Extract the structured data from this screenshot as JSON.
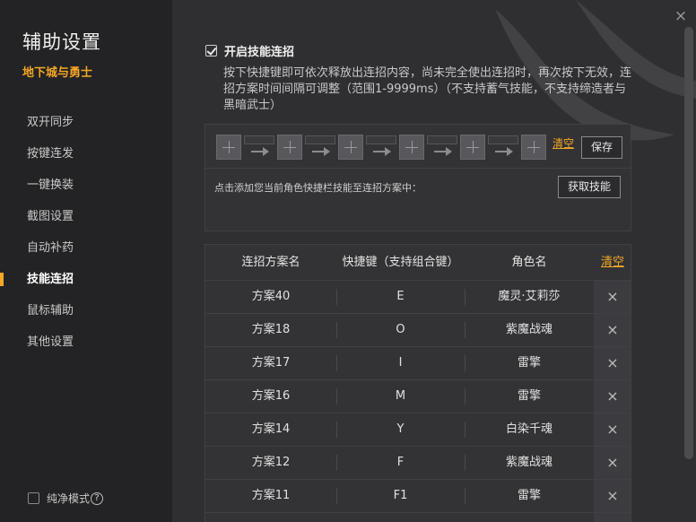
{
  "sidebar": {
    "title": "辅助设置",
    "game": "地下城与勇士",
    "items": [
      {
        "label": "双开同步"
      },
      {
        "label": "按键连发"
      },
      {
        "label": "一键换装"
      },
      {
        "label": "截图设置"
      },
      {
        "label": "自动补药"
      },
      {
        "label": "技能连招"
      },
      {
        "label": "鼠标辅助"
      },
      {
        "label": "其他设置"
      }
    ],
    "active_item": "技能连招",
    "pure_mode_label": "纯净模式"
  },
  "main": {
    "close_glyph": "×",
    "enable_label": "开启技能连招",
    "enable_checked": true,
    "description": "按下快捷键即可依次释放出连招内容，尚未完全使出连招时，再次按下无效，连招方案时间间隔可调整（范围1-9999ms）（不支持蓄气技能，不支持缔造者与黑暗武士）",
    "combo": {
      "slot_icon": "plus-icon",
      "slot_count": 6,
      "clear_label": "清空",
      "save_label": "保存",
      "hint": "点击添加您当前角色快捷栏技能至连招方案中：",
      "fetch_label": "获取技能"
    },
    "table": {
      "headers": {
        "name": "连招方案名",
        "hotkey": "快捷键（支持组合键）",
        "role": "角色名",
        "clear": "清空"
      },
      "rows": [
        {
          "name": "方案40",
          "hotkey": "E",
          "role": "魔灵·艾莉莎"
        },
        {
          "name": "方案18",
          "hotkey": "O",
          "role": "紫魔战魂"
        },
        {
          "name": "方案17",
          "hotkey": "I",
          "role": "雷擎"
        },
        {
          "name": "方案16",
          "hotkey": "M",
          "role": "雷擎"
        },
        {
          "name": "方案14",
          "hotkey": "Y",
          "role": "白染千魂"
        },
        {
          "name": "方案12",
          "hotkey": "F",
          "role": "紫魔战魂"
        },
        {
          "name": "方案11",
          "hotkey": "F1",
          "role": "雷擎"
        }
      ],
      "delete_glyph": "×"
    }
  },
  "colors": {
    "accent": "#f5a623",
    "sidebar_bg": "#232325",
    "main_bg": "#2f2f32"
  }
}
